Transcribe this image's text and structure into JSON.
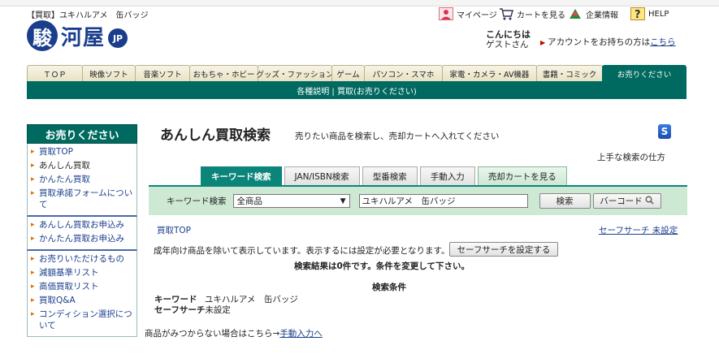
{
  "header": {
    "page_heading": "【買取】ユキハルアメ　缶バッジ",
    "mypage": "マイページ",
    "cart": "カートを見る",
    "corporate": "企業情報",
    "help": "HELP",
    "greeting": "こんにちは",
    "guest": "ゲストさん",
    "account_prefix": "アカウントをお持ちの方は",
    "account_link": "こちら"
  },
  "logo": {
    "mark": "駿",
    "text": "河屋",
    "jp": "JP"
  },
  "nav": {
    "tabs": [
      "ＴＯＰ",
      "映像ソフト",
      "音楽ソフト",
      "おもちゃ・ホビー",
      "グッズ・ファッション",
      "ゲーム",
      "パソコン・スマホ",
      "家電・カメラ・AV機器",
      "書籍・コミック",
      "お売りください"
    ],
    "subnav": "各種説明 | 買取(お売りください)"
  },
  "sidebar": {
    "title": "お売りください",
    "group1": [
      "買取TOP",
      "あんしん買取",
      "かんたん買取",
      "買取承諾フォームについて"
    ],
    "group2": [
      "あんしん買取お申込み",
      "かんたん買取お申込み"
    ],
    "group3": [
      "お売りいただけるもの",
      "減額基準リスト",
      "高価買取リスト",
      "買取Q&A",
      "コンディション選択について"
    ]
  },
  "main": {
    "title": "あんしん買取検索",
    "description": "売りたい商品を検索し、売却カートへ入れてください",
    "s_badge": "S",
    "tips": "上手な検索の仕方",
    "tabs": [
      "キーワード検索",
      "JAN/ISBN検索",
      "型番検索",
      "手動入力",
      "売却カートを見る"
    ],
    "search": {
      "label": "キーワード検索",
      "category": "全商品",
      "keyword": "ユキハルアメ　缶バッジ",
      "button": "検索",
      "barcode": "バーコード"
    },
    "breadcrumb": "買取TOP",
    "safe_search_status": "セーフサーチ 未設定",
    "adult_note": "成年向け商品を除いて表示しています。表示するには設定が必要となります。",
    "adult_button": "セーフサーチを設定する",
    "result": "検索結果は0件です。条件を変更して下さい。",
    "conditions_title": "検索条件",
    "cond_keyword_label": "キーワード",
    "cond_keyword_value": "ユキハルアメ　缶バッジ",
    "cond_safe_label": "セーフサーチ",
    "cond_safe_value": "未設定",
    "notfound_prefix": "商品がみつからない場合はこちら→",
    "notfound_link": "手動入力へ"
  }
}
